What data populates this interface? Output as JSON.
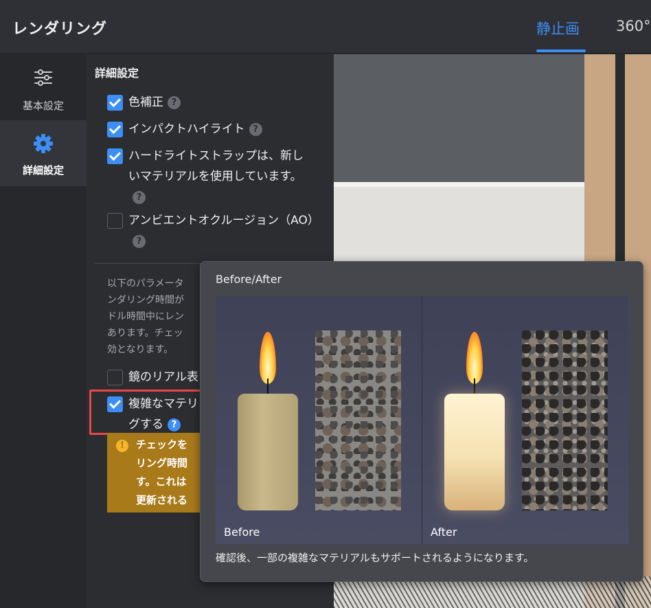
{
  "header": {
    "title": "レンダリング",
    "tabs": [
      {
        "label": "静止画",
        "active": true
      },
      {
        "label": "360°",
        "active": false
      }
    ],
    "accent_color": "#3d8ef5"
  },
  "rail": {
    "items": [
      {
        "label": "基本設定",
        "icon": "sliders-icon",
        "active": false
      },
      {
        "label": "詳細設定",
        "icon": "gear-icon",
        "active": true
      }
    ]
  },
  "panel": {
    "section_title": "詳細設定",
    "options": [
      {
        "label": "色補正",
        "checked": true
      },
      {
        "label": "インパクトハイライト",
        "checked": true
      },
      {
        "label": "ハードライトストラップは、新しいマテリアルを使用しています。",
        "checked": true
      },
      {
        "label": "アンビエントオクルージョン（AO）",
        "checked": false
      },
      {
        "label": "鏡のリアル表",
        "checked": false
      },
      {
        "label": "複雑なマテリアルをレンダリングする",
        "label_visible": "複雑なマテリ\nグする",
        "checked": true
      }
    ],
    "description": "以下のパラメータ\nンダリング時間が\nドル時間中にレン\nあります。チェッ\n効となります。",
    "warning": "チェックを\nリング時間\nす。これは\n更新される"
  },
  "popup": {
    "title": "Before/After",
    "before_label": "Before",
    "after_label": "After",
    "caption": "確認後、一部の複雑なマテリアルもサポートされるようになります。"
  }
}
